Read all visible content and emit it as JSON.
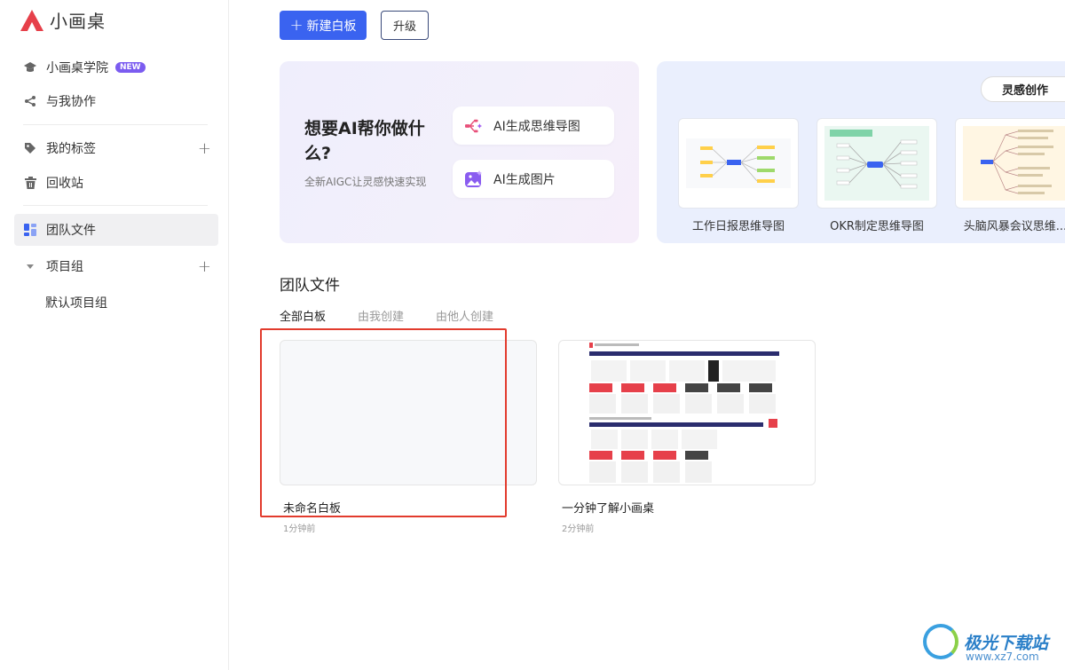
{
  "app": {
    "name": "小画桌",
    "brand_color": "#e6404a",
    "accent": "#3a63f0"
  },
  "sidebar": {
    "items": [
      {
        "label": "小画桌学院",
        "icon": "graduation-cap-icon",
        "badge": "NEW"
      },
      {
        "label": "与我协作",
        "icon": "share-icon"
      },
      {
        "label": "我的标签",
        "icon": "tag-icon"
      },
      {
        "label": "回收站",
        "icon": "trash-icon"
      },
      {
        "label": "团队文件",
        "icon": "team-files-icon",
        "active": true
      },
      {
        "label": "项目组",
        "icon": "caret-down-icon"
      }
    ],
    "sub_items": [
      "默认项目组"
    ]
  },
  "toolbar": {
    "new_board": "新建白板",
    "upgrade": "升级"
  },
  "ai": {
    "title": "想要AI帮你做什么?",
    "subtitle": "全新AIGC让灵感快速实现",
    "btn_mindmap": "AI生成思维导图",
    "btn_image": "AI生成图片"
  },
  "inspiration": {
    "tag": "灵感创作",
    "templates": [
      "工作日报思维导图",
      "OKR制定思维导图",
      "头脑风暴会议思维..."
    ]
  },
  "team": {
    "title": "团队文件",
    "tabs": [
      "全部白板",
      "由我创建",
      "由他人创建"
    ],
    "cards": [
      {
        "name": "未命名白板",
        "time": "1分钟前"
      },
      {
        "name": "一分钟了解小画桌",
        "time": "2分钟前"
      }
    ]
  },
  "watermark": {
    "name": "极光下载站",
    "url": "www.xz7.com"
  }
}
